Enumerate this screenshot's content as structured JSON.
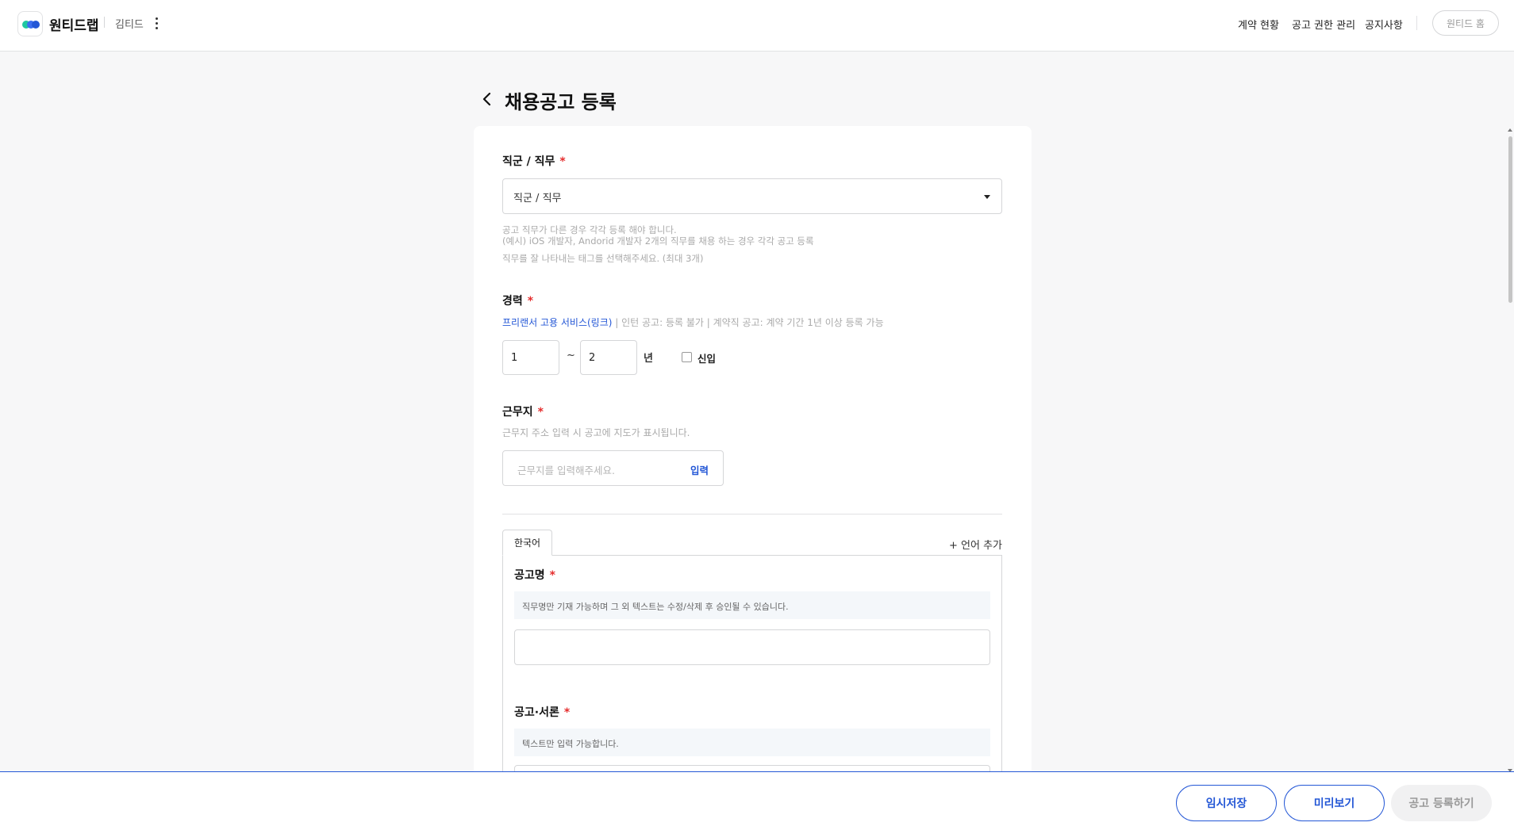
{
  "header": {
    "brand": "원티드랩",
    "company": "김티드",
    "nav": [
      "계약 현황",
      "공고 권한 관리",
      "공지사항"
    ],
    "home_button": "원티드 홈",
    "logo_colors": [
      "#1fc8a0",
      "#2457d6",
      "#3c6ef0"
    ]
  },
  "page": {
    "title": "채용공고 등록"
  },
  "job": {
    "label": "직군 / 직무",
    "select_value": "직군 / 직무",
    "help": [
      "공고 직무가 다른 경우 각각 등록 해야 합니다.",
      "(예시) iOS 개발자, Andorid 개발자 2개의 직무를 채용 하는 경우 각각 공고 등록",
      "직무를 잘 나타내는 태그를 선택해주세요. (최대 3개)"
    ]
  },
  "career": {
    "label": "경력",
    "freelance_link": "프리랜서 고용 서비스(링크)",
    "note": " | 인턴 공고: 등록 불가 | 계약직 공고: 계약 기간 1년 이상 등록 가능",
    "min": "1",
    "max": "2",
    "separator": "~",
    "unit": "년",
    "newcomer_label": "신입"
  },
  "location": {
    "label": "근무지",
    "help": "근무지 주소 입력 시 공고에 지도가 표시됩니다.",
    "placeholder": "근무지를 입력해주세요.",
    "button": "입력"
  },
  "language": {
    "tab": "한국어",
    "add": "+ 언어 추가"
  },
  "posting_title": {
    "label": "공고명",
    "notice": "직무명만 기재 가능하며 그 외 텍스트는 수정/삭제 후 승인될 수 있습니다.",
    "value": ""
  },
  "intro": {
    "label": "공고·서론",
    "notice": "텍스트만 입력 가능합니다."
  },
  "footer": {
    "save_draft": "임시저장",
    "preview": "미리보기",
    "submit": "공고 등록하기"
  }
}
